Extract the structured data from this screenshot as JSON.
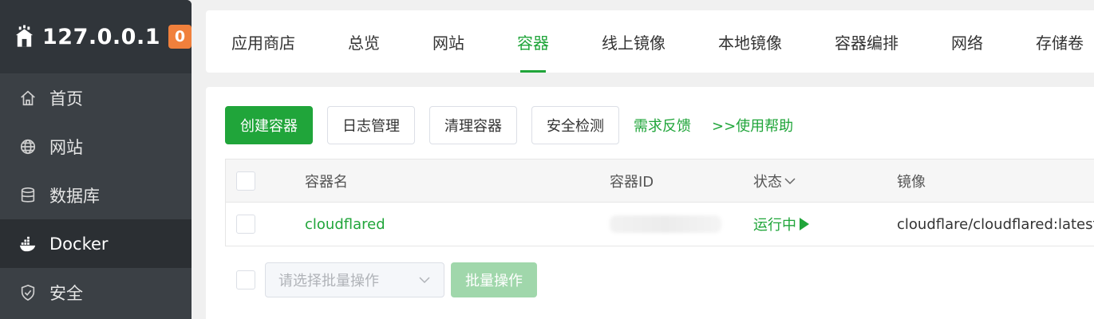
{
  "sidebar": {
    "host": "127.0.0.1",
    "badge": "0",
    "items": [
      {
        "label": "首页",
        "icon": "home-icon"
      },
      {
        "label": "网站",
        "icon": "globe-icon"
      },
      {
        "label": "数据库",
        "icon": "database-icon"
      },
      {
        "label": "Docker",
        "icon": "docker-icon",
        "active": true
      },
      {
        "label": "安全",
        "icon": "shield-icon"
      }
    ]
  },
  "tabs": [
    {
      "label": "应用商店"
    },
    {
      "label": "总览"
    },
    {
      "label": "网站"
    },
    {
      "label": "容器",
      "active": true
    },
    {
      "label": "线上镜像"
    },
    {
      "label": "本地镜像"
    },
    {
      "label": "容器编排"
    },
    {
      "label": "网络"
    },
    {
      "label": "存储卷"
    }
  ],
  "toolbar": {
    "create": "创建容器",
    "logs": "日志管理",
    "clean": "清理容器",
    "security": "安全检测",
    "feedback": "需求反馈",
    "help": ">>使用帮助"
  },
  "table": {
    "headers": {
      "name": "容器名",
      "id": "容器ID",
      "status": "状态",
      "image": "镜像"
    },
    "rows": [
      {
        "name": "cloudflared",
        "id": "",
        "status": "运行中",
        "image": "cloudflare/cloudflared:latest"
      }
    ]
  },
  "footer": {
    "placeholder": "请选择批量操作",
    "batch": "批量操作"
  },
  "colors": {
    "accent": "#20a53a",
    "sidebar": "#3b4045",
    "badge": "#f0803c"
  }
}
